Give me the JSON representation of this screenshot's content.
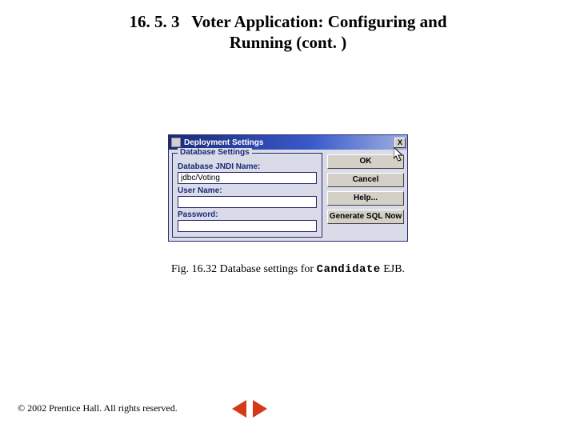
{
  "heading": {
    "section_number": "16. 5. 3",
    "title_line1": "Voter Application: Configuring and",
    "title_line2": "Running (cont. )"
  },
  "dialog": {
    "title": "Deployment Settings",
    "group_label": "Database Settings",
    "fields": {
      "jndi_label": "Database JNDI Name:",
      "jndi_value": "jdbc/Voting",
      "user_label": "User Name:",
      "user_value": "",
      "pass_label": "Password:",
      "pass_value": ""
    },
    "buttons": {
      "ok": "OK",
      "cancel": "Cancel",
      "help": "Help...",
      "gensql": "Generate SQL Now"
    },
    "close_glyph": "X"
  },
  "caption": {
    "prefix": "Fig. 16.32 Database settings for ",
    "code": "Candidate",
    "suffix": " EJB."
  },
  "footer": {
    "copyright_symbol": "©",
    "text": " 2002 Prentice Hall. All rights reserved."
  }
}
